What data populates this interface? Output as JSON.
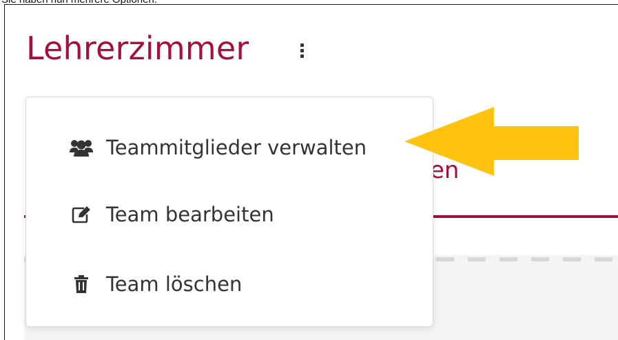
{
  "caption": "Sie haben nun mehrere Optionen.",
  "header": {
    "title": "Lehrerzimmer"
  },
  "tabs": {
    "partial_label": "en"
  },
  "menu": {
    "items": [
      {
        "label": "Teammitglieder verwalten",
        "icon": "users-icon"
      },
      {
        "label": "Team bearbeiten",
        "icon": "edit-icon"
      },
      {
        "label": "Team löschen",
        "icon": "trash-icon"
      }
    ]
  },
  "colors": {
    "accent": "#a50f3c",
    "arrow": "#ffc20e",
    "text": "#333333"
  }
}
